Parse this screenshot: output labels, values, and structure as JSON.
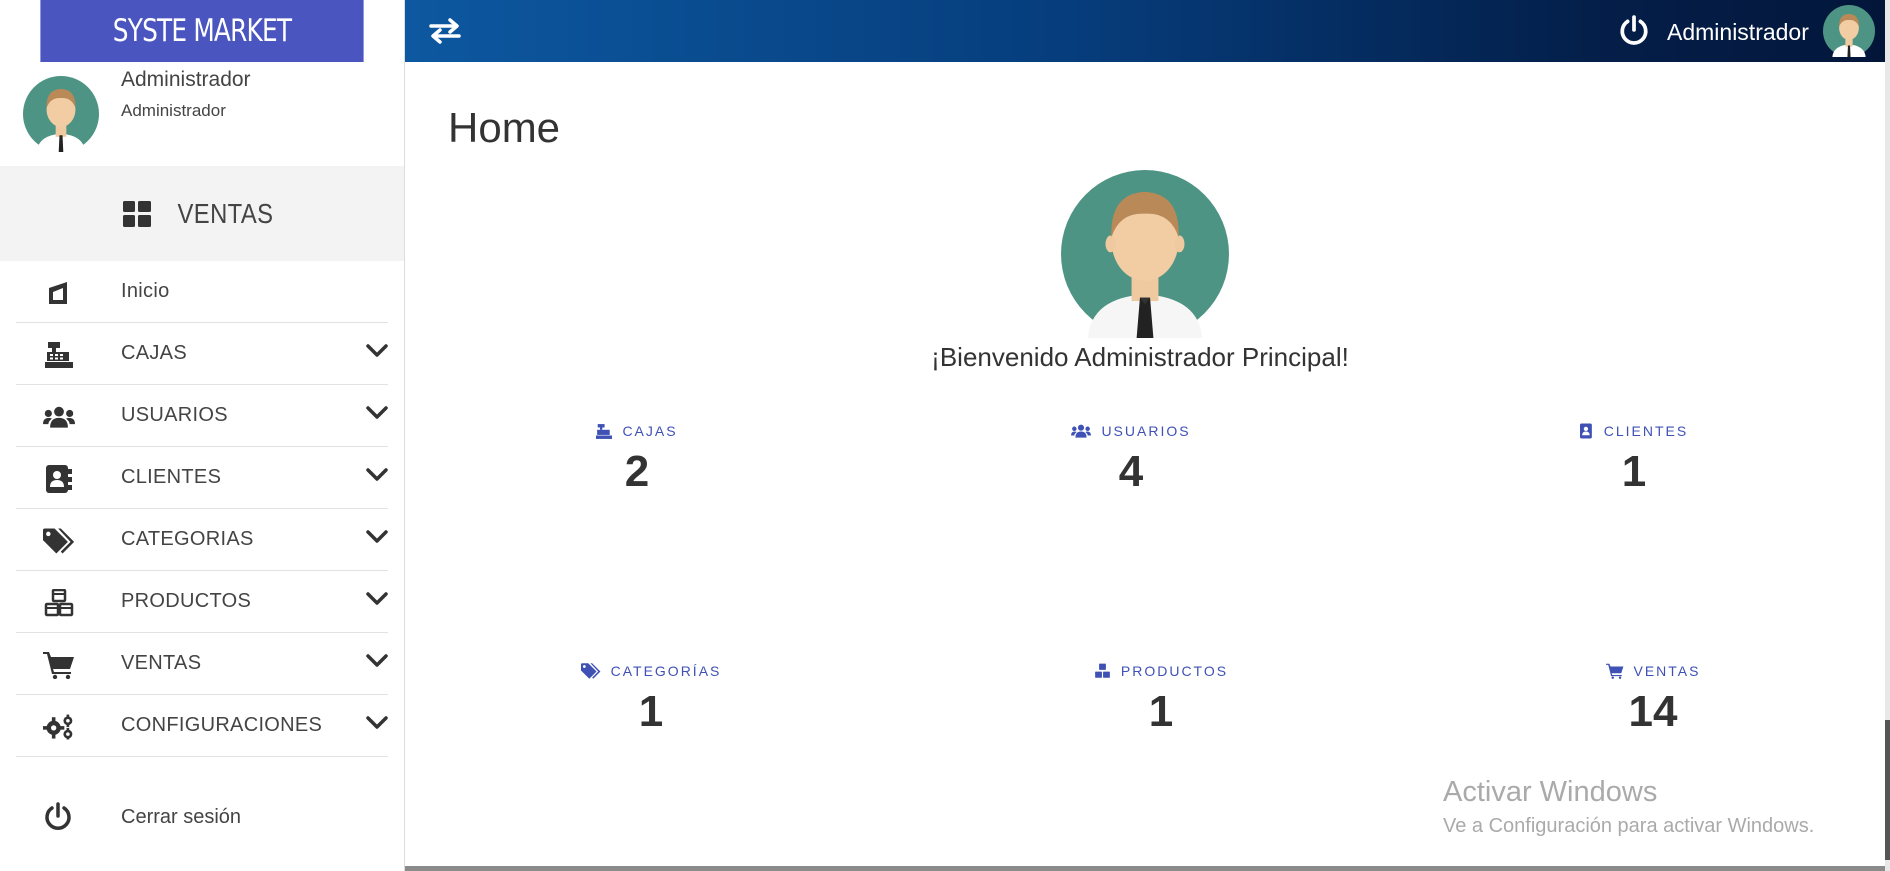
{
  "brand": {
    "title": "SYSTE MARKET",
    "color": "#4a55c0"
  },
  "sidebar": {
    "user": {
      "name": "Administrador",
      "role": "Administrador",
      "avatar": "user-avatar"
    },
    "section_title": "VENTAS",
    "section_icon": "grid-icon",
    "items": [
      {
        "label": "Inicio",
        "icon": "home-icon",
        "has_submenu": false
      },
      {
        "label": "CAJAS",
        "icon": "cash-register-icon",
        "has_submenu": true
      },
      {
        "label": "USUARIOS",
        "icon": "users-icon",
        "has_submenu": true
      },
      {
        "label": "CLIENTES",
        "icon": "address-book-icon",
        "has_submenu": true
      },
      {
        "label": "CATEGORIAS",
        "icon": "tags-icon",
        "has_submenu": true
      },
      {
        "label": "PRODUCTOS",
        "icon": "cubes-icon",
        "has_submenu": true
      },
      {
        "label": "VENTAS",
        "icon": "cart-icon",
        "has_submenu": true
      },
      {
        "label": "CONFIGURACIONES",
        "icon": "gears-icon",
        "has_submenu": true
      }
    ],
    "logout_label": "Cerrar sesión"
  },
  "topbar": {
    "user_name": "Administrador",
    "gradient": [
      "#0d58a0",
      "#03163a"
    ]
  },
  "main": {
    "title": "Home",
    "welcome": "¡Bienvenido Administrador Principal!",
    "accent": "#3f51b5",
    "stats": [
      {
        "label": "CAJAS",
        "value": "2",
        "icon": "cash-register-icon"
      },
      {
        "label": "USUARIOS",
        "value": "4",
        "icon": "users-icon"
      },
      {
        "label": "CLIENTES",
        "value": "1",
        "icon": "address-book-icon"
      },
      {
        "label": "CATEGORÍAS",
        "value": "1",
        "icon": "tags-icon"
      },
      {
        "label": "PRODUCTOS",
        "value": "1",
        "icon": "cubes-icon"
      },
      {
        "label": "VENTAS",
        "value": "14",
        "icon": "cart-icon"
      }
    ]
  },
  "watermark": {
    "line1": "Activar Windows",
    "line2": "Ve a Configuración para activar Windows."
  }
}
